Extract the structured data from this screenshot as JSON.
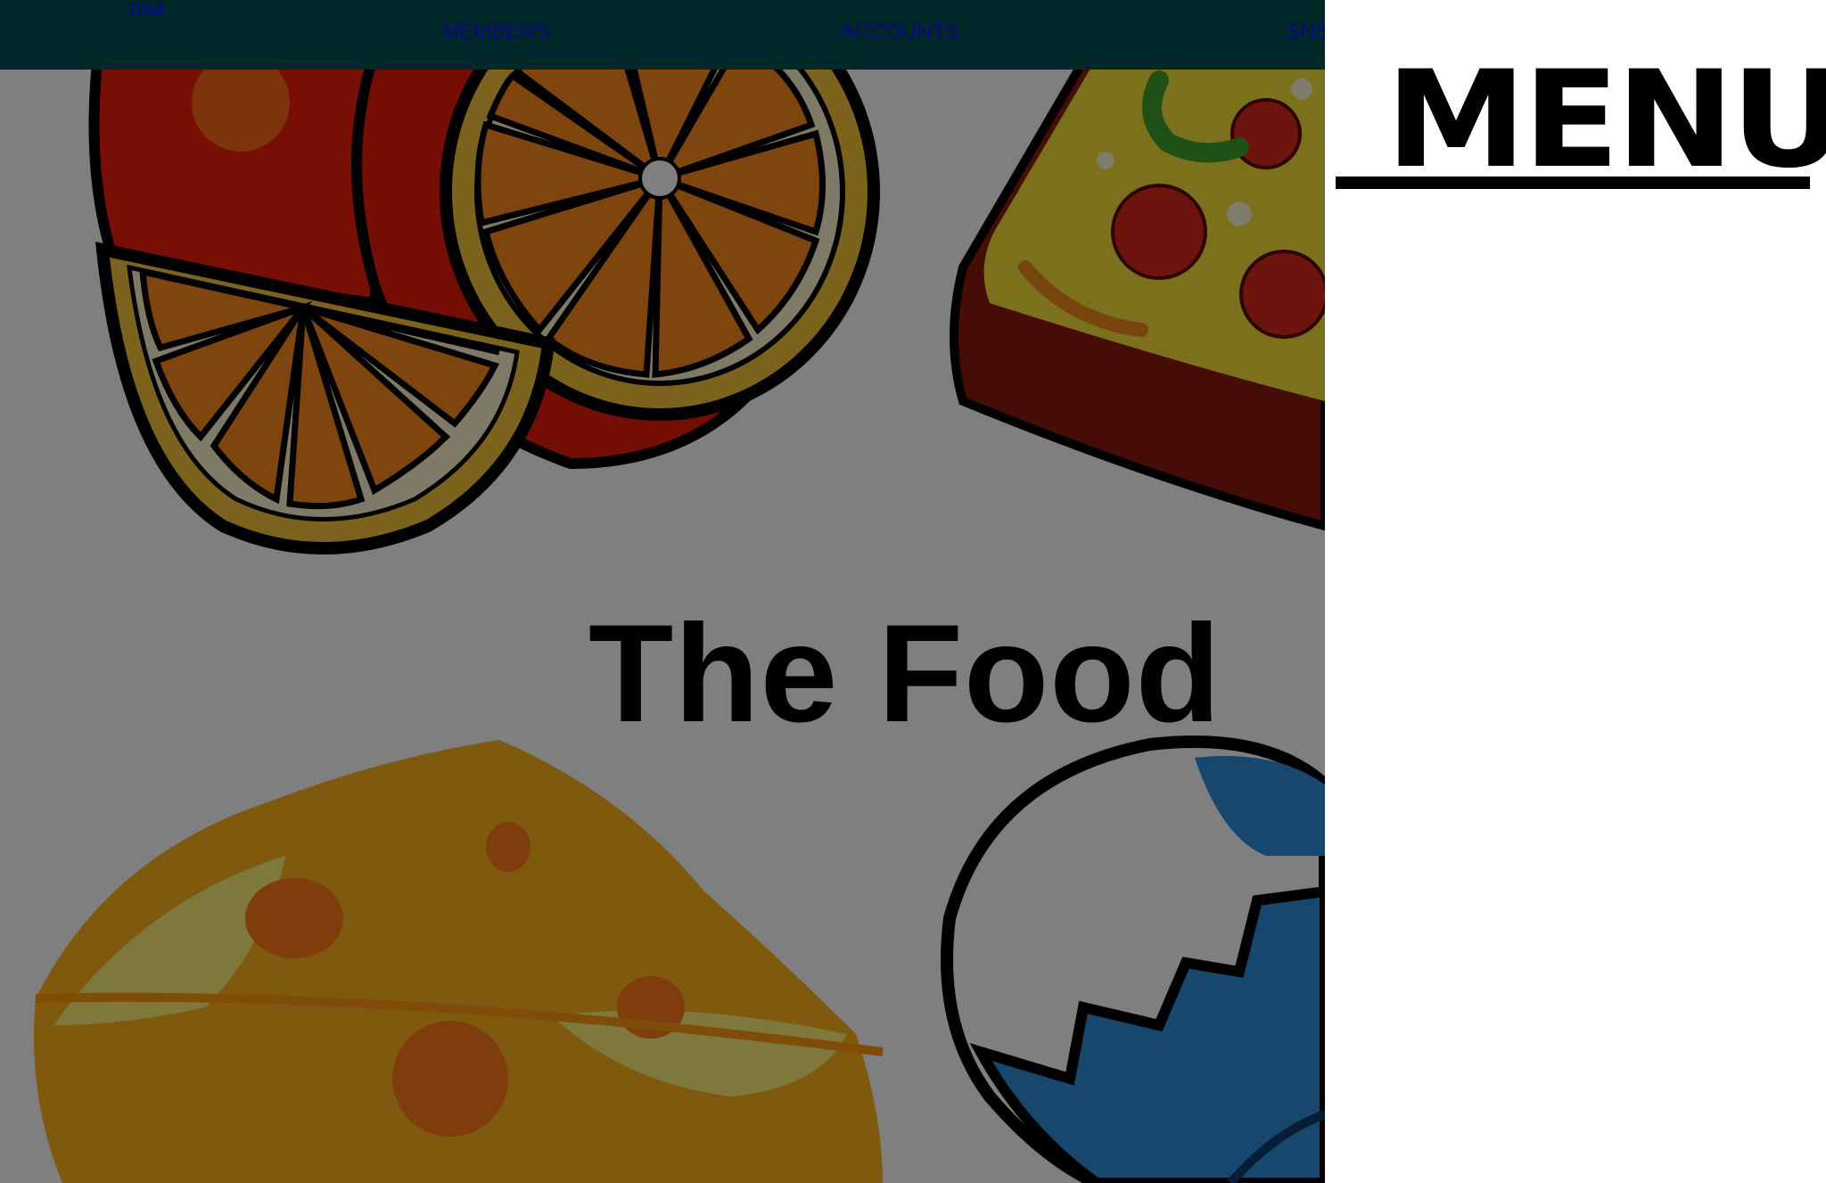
{
  "header": {
    "site_title": "TITLE",
    "nav_links": [
      {
        "label": "MEMBERS"
      },
      {
        "label": "ACCOUNTS"
      },
      {
        "label": "SNS"
      }
    ],
    "background_color": "#002828",
    "link_color": "#0a0a80"
  },
  "hero": {
    "title": "The Food",
    "illustrations": [
      "oranges-illustration",
      "pizza-slice-illustration",
      "cheese-illustration",
      "cracked-egg-illustration"
    ],
    "overlay": "dimmed"
  },
  "side_menu": {
    "heading": "MENU"
  }
}
